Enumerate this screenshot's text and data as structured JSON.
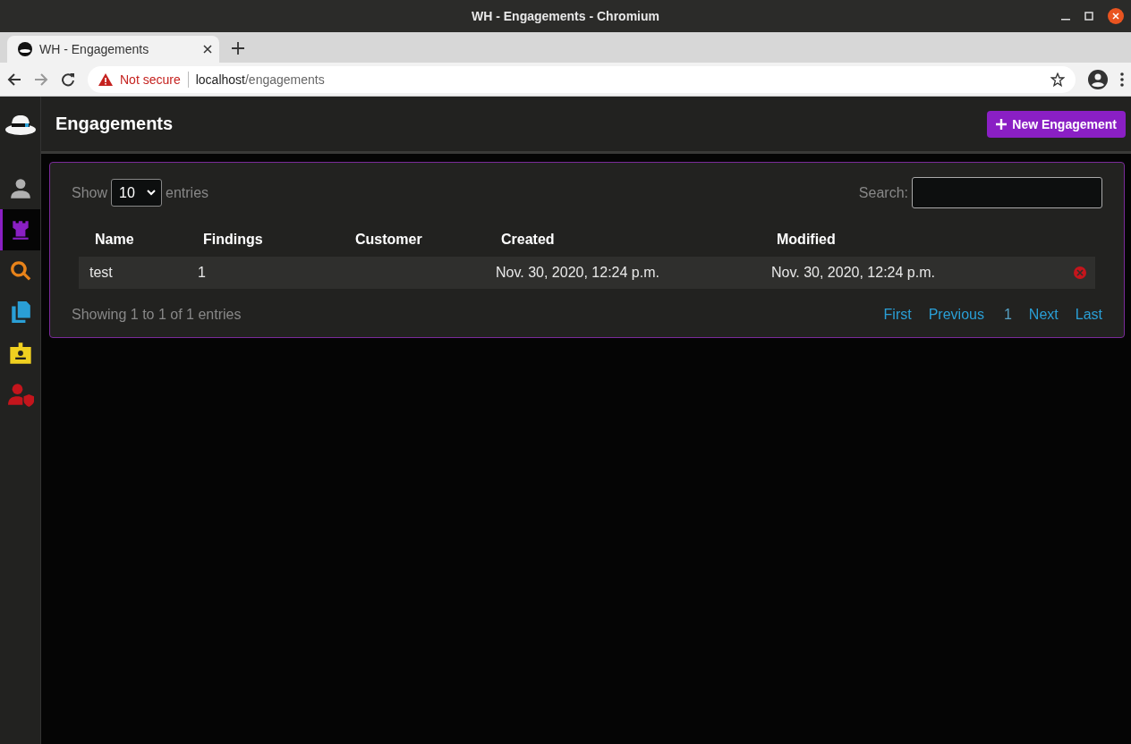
{
  "window": {
    "title": "WH - Engagements - Chromium"
  },
  "browser": {
    "tabs": [
      {
        "label": "WH - Engagements",
        "selected": true
      }
    ],
    "security": "Not secure",
    "url_host": "localhost",
    "url_path": "/engagements"
  },
  "sidebar": {
    "items": [
      {
        "color": "#b0b0b0",
        "selected": false
      },
      {
        "color": "#8a1fc4",
        "selected": true
      },
      {
        "color": "#e8831a",
        "selected": false
      },
      {
        "color": "#2a9fd6",
        "selected": false
      },
      {
        "color": "#f0d020",
        "selected": false
      },
      {
        "color": "#c4151c",
        "selected": false
      }
    ]
  },
  "header": {
    "title": "Engagements",
    "button": "New Engagement"
  },
  "table_controls": {
    "show_label": "Show",
    "page_size": "10",
    "entries_label": "entries",
    "search_label": "Search:"
  },
  "table": {
    "columns": [
      "Name",
      "Findings",
      "Customer",
      "Created",
      "Modified"
    ],
    "rows": [
      {
        "cells": [
          "test",
          "1",
          "",
          "Nov. 30, 2020, 12:24 p.m.",
          "Nov. 30, 2020, 12:24 p.m."
        ]
      }
    ]
  },
  "footer": {
    "info": "Showing 1 to 1 of 1 entries",
    "pagination": [
      {
        "label": "First",
        "selected": false
      },
      {
        "label": "Previous",
        "selected": false
      },
      {
        "label": "1",
        "selected": true
      },
      {
        "label": "Next",
        "selected": false
      },
      {
        "label": "Last",
        "selected": false
      }
    ]
  }
}
